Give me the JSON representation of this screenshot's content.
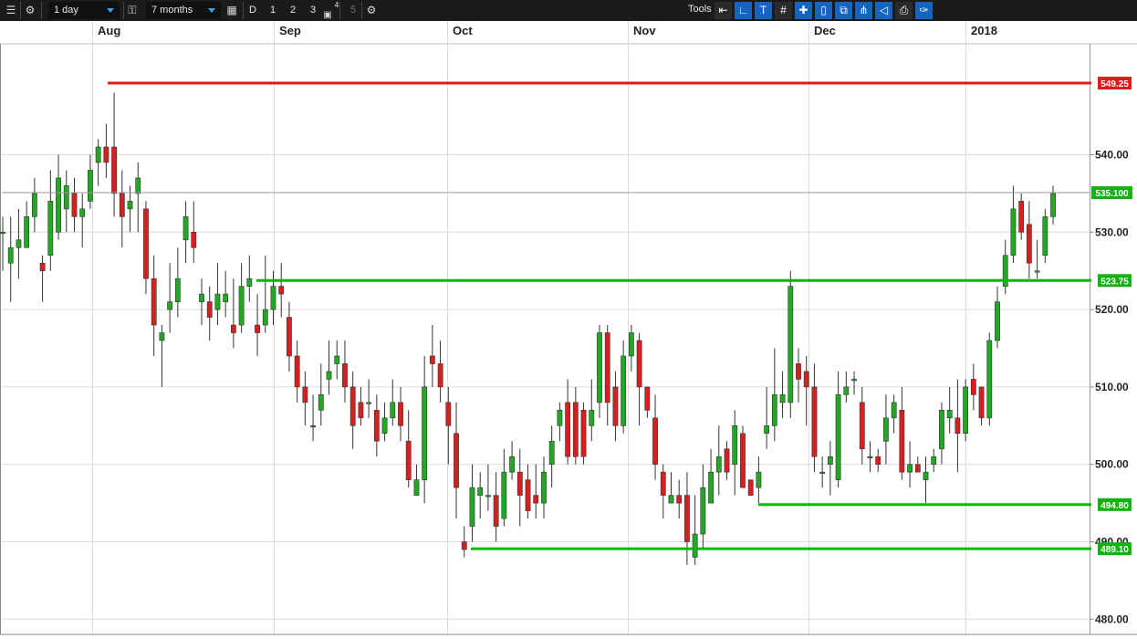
{
  "toolbar": {
    "interval": "1 day",
    "range": "7 months",
    "period_buttons": [
      "D",
      "1",
      "2",
      "3",
      "4",
      "5"
    ],
    "tools_label": "Tools",
    "icons": [
      "list-icon",
      "gear-icon",
      "lock-icon",
      "calendar-icon",
      "bookmark-icon",
      "gear-icon",
      "arrow-left-icon",
      "line-tool-icon",
      "text-tool-icon",
      "grid-icon",
      "crosshair-icon",
      "candle-icon",
      "layers-icon",
      "fork-icon",
      "fork-alt-icon",
      "label-tool-icon",
      "print-icon",
      "settings-tool-icon"
    ]
  },
  "chart_data": {
    "type": "candlestick",
    "x_labels": [
      "Aug",
      "Sep",
      "Oct",
      "Nov",
      "Dec",
      "2018"
    ],
    "y_ticks": [
      "480.00",
      "490.00",
      "500.00",
      "510.00",
      "520.00",
      "530.00",
      "540.00"
    ],
    "ylim": [
      479,
      555
    ],
    "grid": true,
    "current_price": "535.100",
    "levels": [
      {
        "label": "549.25",
        "value": 549.25,
        "color": "#e01b1b"
      },
      {
        "label": "523.75",
        "value": 523.75,
        "color": "#11b311"
      },
      {
        "label": "494.80",
        "value": 494.8,
        "color": "#11b311"
      },
      {
        "label": "489.10",
        "value": 489.1,
        "color": "#11b311"
      }
    ],
    "candles": [
      [
        530,
        530,
        525,
        532
      ],
      [
        526,
        528,
        521,
        532
      ],
      [
        528,
        529,
        524,
        533
      ],
      [
        528,
        532,
        528,
        534
      ],
      [
        532,
        535,
        530,
        537
      ],
      [
        526,
        525,
        521,
        527
      ],
      [
        527,
        534,
        525,
        538
      ],
      [
        530,
        537,
        529,
        540
      ],
      [
        533,
        536,
        530,
        538
      ],
      [
        535,
        532,
        530,
        537
      ],
      [
        532,
        533,
        528,
        535
      ],
      [
        534,
        538,
        533,
        540
      ],
      [
        539,
        541,
        536,
        542
      ],
      [
        541,
        539,
        537,
        544
      ],
      [
        541,
        535,
        532,
        548
      ],
      [
        535,
        532,
        528,
        538
      ],
      [
        533,
        534,
        530,
        536
      ],
      [
        535,
        537,
        530,
        539
      ],
      [
        533,
        524,
        522,
        534
      ],
      [
        524,
        518,
        514,
        527
      ],
      [
        516,
        517,
        510,
        518
      ],
      [
        520,
        521,
        517,
        526
      ],
      [
        521,
        524,
        519,
        528
      ],
      [
        529,
        532,
        526,
        534
      ],
      [
        530,
        528,
        526,
        534
      ],
      [
        521,
        522,
        518,
        524
      ],
      [
        521,
        519,
        516,
        523
      ],
      [
        520,
        522,
        518,
        526
      ],
      [
        521,
        522,
        519,
        525
      ],
      [
        518,
        517,
        515,
        524
      ],
      [
        518,
        523,
        517,
        526
      ],
      [
        523,
        524,
        521,
        527
      ],
      [
        518,
        517,
        514,
        522
      ],
      [
        518,
        520,
        517,
        527
      ],
      [
        520,
        523,
        518,
        525
      ],
      [
        523,
        522,
        519,
        526
      ],
      [
        519,
        514,
        512,
        521
      ],
      [
        514,
        510,
        508,
        516
      ],
      [
        510,
        508,
        505,
        512
      ],
      [
        505,
        505,
        503,
        509
      ],
      [
        507,
        509,
        505,
        513
      ],
      [
        511,
        512,
        509,
        516
      ],
      [
        513,
        514,
        511,
        516
      ],
      [
        513,
        510,
        508,
        516
      ],
      [
        510,
        505,
        502,
        512
      ],
      [
        508,
        506,
        505,
        510
      ],
      [
        508,
        508,
        506,
        511
      ],
      [
        507,
        503,
        501,
        509
      ],
      [
        504,
        506,
        503,
        508
      ],
      [
        506,
        508,
        505,
        511
      ],
      [
        508,
        505,
        503,
        510
      ],
      [
        503,
        498,
        497,
        507
      ],
      [
        496,
        498,
        496,
        500
      ],
      [
        498,
        510,
        495,
        514
      ],
      [
        514,
        513,
        510,
        518
      ],
      [
        513,
        510,
        508,
        516
      ],
      [
        508,
        505,
        500,
        510
      ],
      [
        504,
        497,
        493,
        508
      ],
      [
        490,
        489,
        488,
        492
      ],
      [
        492,
        497,
        490,
        500
      ],
      [
        496,
        497,
        493,
        499
      ],
      [
        496,
        496,
        494,
        500
      ],
      [
        496,
        492,
        490,
        499
      ],
      [
        493,
        499,
        492,
        502
      ],
      [
        499,
        501,
        498,
        503
      ],
      [
        499,
        496,
        492,
        502
      ],
      [
        498,
        494,
        493,
        500
      ],
      [
        496,
        495,
        493,
        500
      ],
      [
        495,
        499,
        493,
        501
      ],
      [
        500,
        503,
        497,
        505
      ],
      [
        505,
        507,
        503,
        508
      ],
      [
        508,
        501,
        500,
        511
      ],
      [
        508,
        501,
        500,
        510
      ],
      [
        507,
        501,
        500,
        508
      ],
      [
        505,
        507,
        503,
        511
      ],
      [
        508,
        517,
        506,
        518
      ],
      [
        517,
        508,
        505,
        518
      ],
      [
        510,
        505,
        503,
        512
      ],
      [
        505,
        514,
        504,
        516
      ],
      [
        514,
        517,
        512,
        518
      ],
      [
        516,
        510,
        505,
        517
      ],
      [
        510,
        507,
        506,
        510
      ],
      [
        506,
        500,
        498,
        509
      ],
      [
        499,
        496,
        493,
        500
      ],
      [
        495,
        496,
        495,
        499
      ],
      [
        496,
        495,
        493,
        498
      ],
      [
        496,
        490,
        487,
        499
      ],
      [
        488,
        491,
        487,
        496
      ],
      [
        491,
        497,
        489,
        500
      ],
      [
        495,
        499,
        497,
        502
      ],
      [
        499,
        501,
        496,
        505
      ],
      [
        502,
        499,
        498,
        503
      ],
      [
        500,
        505,
        496,
        507
      ],
      [
        504,
        497,
        497,
        505
      ],
      [
        498,
        496,
        497,
        498
      ],
      [
        497,
        499,
        495,
        501
      ],
      [
        504,
        505,
        502,
        510
      ],
      [
        505,
        509,
        503,
        515
      ],
      [
        508,
        509,
        506,
        512
      ],
      [
        508,
        523,
        506,
        525
      ],
      [
        513,
        511,
        508,
        515
      ],
      [
        512,
        510,
        505,
        514
      ],
      [
        510,
        501,
        499,
        513
      ],
      [
        499,
        499,
        497,
        501
      ],
      [
        500,
        501,
        496,
        503
      ],
      [
        498,
        509,
        497,
        512
      ],
      [
        509,
        510,
        508,
        512
      ],
      [
        511,
        511,
        509,
        512
      ],
      [
        508,
        502,
        500,
        510
      ],
      [
        501,
        501,
        499,
        503
      ],
      [
        501,
        500,
        499,
        502
      ],
      [
        503,
        506,
        500,
        509
      ],
      [
        506,
        508,
        504,
        509
      ],
      [
        507,
        499,
        498,
        510
      ],
      [
        499,
        500,
        497,
        503
      ],
      [
        500,
        499,
        499,
        501
      ],
      [
        498,
        499,
        495,
        501
      ],
      [
        500,
        501,
        499,
        502
      ],
      [
        502,
        507,
        500,
        508
      ],
      [
        506,
        507,
        504,
        510
      ],
      [
        506,
        504,
        499,
        511
      ],
      [
        504,
        510,
        503,
        511
      ],
      [
        511,
        509,
        507,
        513
      ],
      [
        510,
        506,
        505,
        510
      ],
      [
        506,
        516,
        505,
        517
      ],
      [
        516,
        521,
        515,
        523
      ],
      [
        523,
        527,
        522,
        529
      ],
      [
        527,
        533,
        526,
        536
      ],
      [
        534,
        530,
        529,
        535
      ],
      [
        531,
        526,
        524,
        534
      ],
      [
        525,
        525,
        524,
        529
      ],
      [
        527,
        532,
        526,
        533
      ],
      [
        532,
        535,
        531,
        536
      ]
    ]
  }
}
